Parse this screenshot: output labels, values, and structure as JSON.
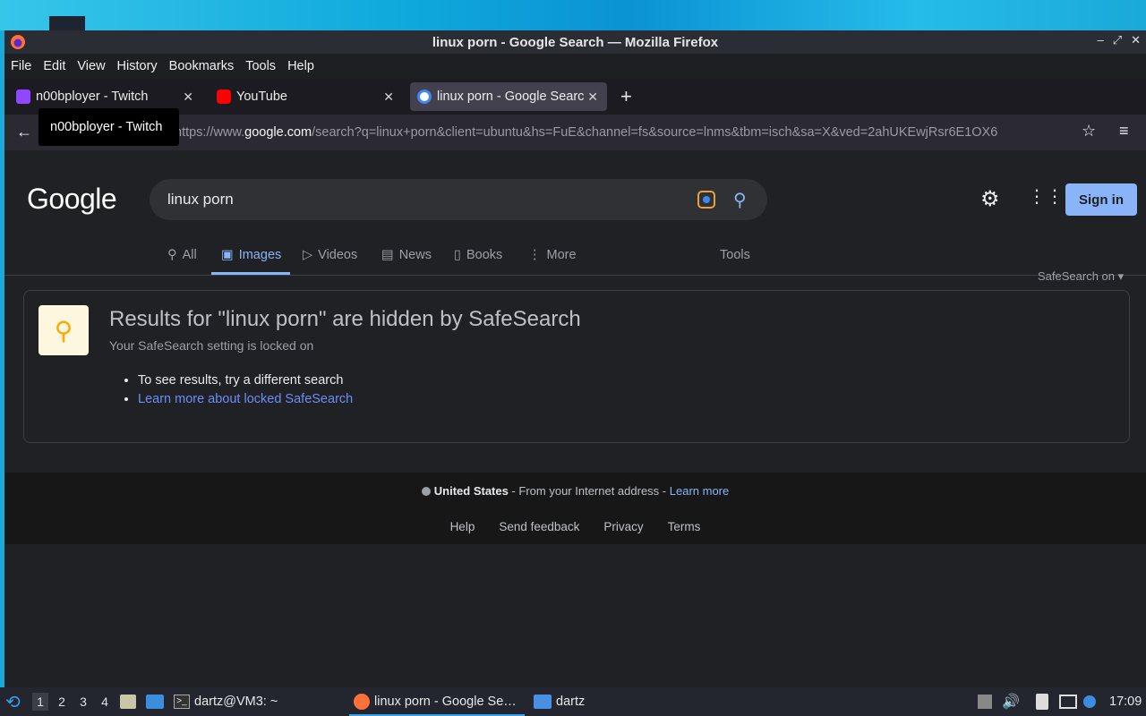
{
  "window": {
    "title": "linux porn - Google Search — Mozilla Firefox",
    "controls": [
      "–",
      "⤢",
      "✕"
    ]
  },
  "menubar": [
    "File",
    "Edit",
    "View",
    "History",
    "Bookmarks",
    "Tools",
    "Help"
  ],
  "tabs": [
    {
      "title": "n00bployer - Twitch",
      "favicon_color": "#9146ff"
    },
    {
      "title": "YouTube",
      "favicon_color": "#ff0000"
    },
    {
      "title": "linux porn - Google Searc",
      "favicon_color": "#ffffff",
      "active": true
    }
  ],
  "tooltip": "n00bployer - Twitch",
  "url": {
    "prefix": "https://www.",
    "domain": "google.com",
    "rest": "/search?q=linux+porn&client=ubuntu&hs=FuE&channel=fs&source=lnms&tbm=isch&sa=X&ved=2ahUKEwjRsr6E1OX6"
  },
  "google": {
    "logo": "Google",
    "query": "linux porn",
    "sign_in": "Sign in",
    "tabs": [
      "All",
      "Images",
      "Videos",
      "News",
      "Books",
      "More"
    ],
    "tools": "Tools",
    "safesearch": "SafeSearch on",
    "notice": {
      "heading": "Results for \"linux porn\" are hidden by SafeSearch",
      "sub": "Your SafeSearch setting is locked on",
      "bullet1": "To see results, try a different search",
      "bullet2": "Learn more about locked SafeSearch"
    },
    "footer": {
      "country": "United States",
      "from": " - From your Internet address - ",
      "learn_more": "Learn more",
      "links": [
        "Help",
        "Send feedback",
        "Privacy",
        "Terms"
      ]
    }
  },
  "taskbar": {
    "workspaces": [
      "1",
      "2",
      "3",
      "4"
    ],
    "terminal": "dartz@VM3: ~",
    "firefox": "linux porn - Google Se…",
    "files": "dartz",
    "clock": "17:09"
  }
}
